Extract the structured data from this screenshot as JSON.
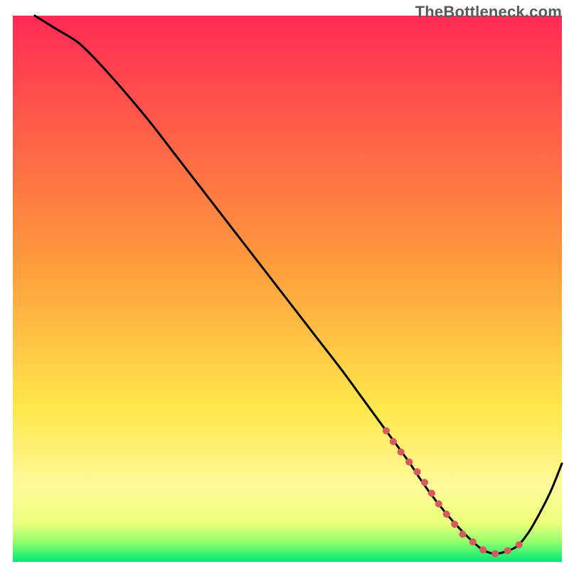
{
  "watermark": "TheBottleneck.com",
  "chart_data": {
    "type": "line",
    "title": "",
    "xlabel": "",
    "ylabel": "",
    "xlim": [
      0,
      100
    ],
    "ylim": [
      0,
      100
    ],
    "grid": false,
    "legend": false,
    "background_gradient": {
      "stops": [
        {
          "offset": 0.0,
          "color": "#ff2a55"
        },
        {
          "offset": 0.45,
          "color": "#ff9a3c"
        },
        {
          "offset": 0.72,
          "color": "#ffe84c"
        },
        {
          "offset": 0.86,
          "color": "#fff99a"
        },
        {
          "offset": 0.93,
          "color": "#eaff7a"
        },
        {
          "offset": 0.965,
          "color": "#8eff6d"
        },
        {
          "offset": 1.0,
          "color": "#00e874"
        }
      ]
    },
    "series": [
      {
        "name": "bottleneck-curve",
        "color": "#000000",
        "x": [
          4,
          8,
          12,
          16,
          20,
          25,
          30,
          35,
          40,
          45,
          50,
          55,
          60,
          64,
          68,
          72,
          75,
          78,
          81,
          84,
          86,
          88,
          90,
          92,
          94,
          96,
          98,
          100
        ],
        "y": [
          100,
          97.5,
          95,
          91,
          86.5,
          80.5,
          74,
          67.5,
          61,
          54.5,
          48,
          41.5,
          35,
          29.5,
          24,
          18.5,
          14,
          10,
          6.5,
          3.5,
          2,
          1.5,
          2,
          3,
          5.5,
          9,
          13,
          18
        ]
      },
      {
        "name": "highlight-segment",
        "color": "#d55b5e",
        "x": [
          68,
          70,
          72,
          74,
          76,
          78,
          80,
          82,
          84,
          86,
          88,
          90,
          92,
          93
        ],
        "y": [
          24,
          21,
          18.5,
          16,
          13,
          10,
          7.5,
          5,
          3.5,
          2,
          1.5,
          2,
          3,
          4
        ]
      }
    ],
    "annotations": []
  }
}
